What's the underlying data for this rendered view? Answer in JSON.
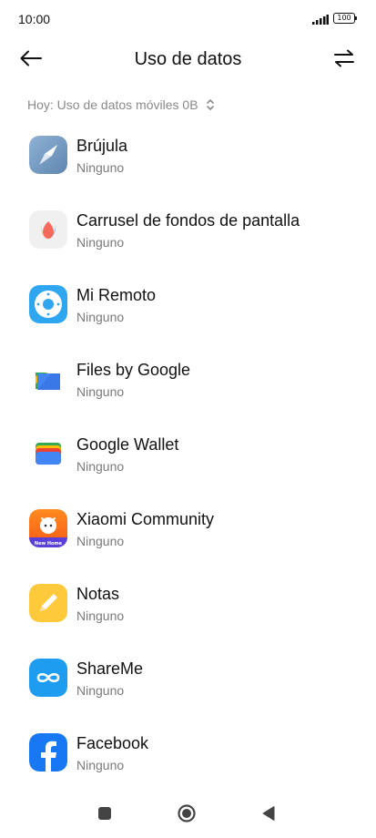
{
  "status_bar": {
    "time": "10:00",
    "battery": "100",
    "signal_icon": "signal-bars-icon"
  },
  "header": {
    "title": "Uso de datos",
    "back_icon": "arrow-left-icon",
    "sort_icon": "swap-arrows-icon"
  },
  "filter": {
    "label": "Hoy: Uso de datos móviles 0B",
    "icon": "chevron-up-down-icon"
  },
  "apps": [
    {
      "name": "Brújula",
      "usage": "Ninguno",
      "icon": "compass-icon"
    },
    {
      "name": "Carrusel de fondos de pantalla",
      "usage": "Ninguno",
      "icon": "wallpaper-carousel-icon"
    },
    {
      "name": "Mi Remoto",
      "usage": "Ninguno",
      "icon": "remote-icon"
    },
    {
      "name": "Files by Google",
      "usage": "Ninguno",
      "icon": "files-icon"
    },
    {
      "name": "Google Wallet",
      "usage": "Ninguno",
      "icon": "wallet-icon"
    },
    {
      "name": "Xiaomi Community",
      "usage": "Ninguno",
      "icon": "xiaomi-community-icon",
      "badge_text": "New Home"
    },
    {
      "name": "Notas",
      "usage": "Ninguno",
      "icon": "notes-icon"
    },
    {
      "name": "ShareMe",
      "usage": "Ninguno",
      "icon": "shareme-icon"
    },
    {
      "name": "Facebook",
      "usage": "Ninguno",
      "icon": "facebook-icon"
    }
  ],
  "nav_bar": {
    "recents_icon": "square-icon",
    "home_icon": "circle-home-icon",
    "back_icon": "triangle-back-icon"
  }
}
